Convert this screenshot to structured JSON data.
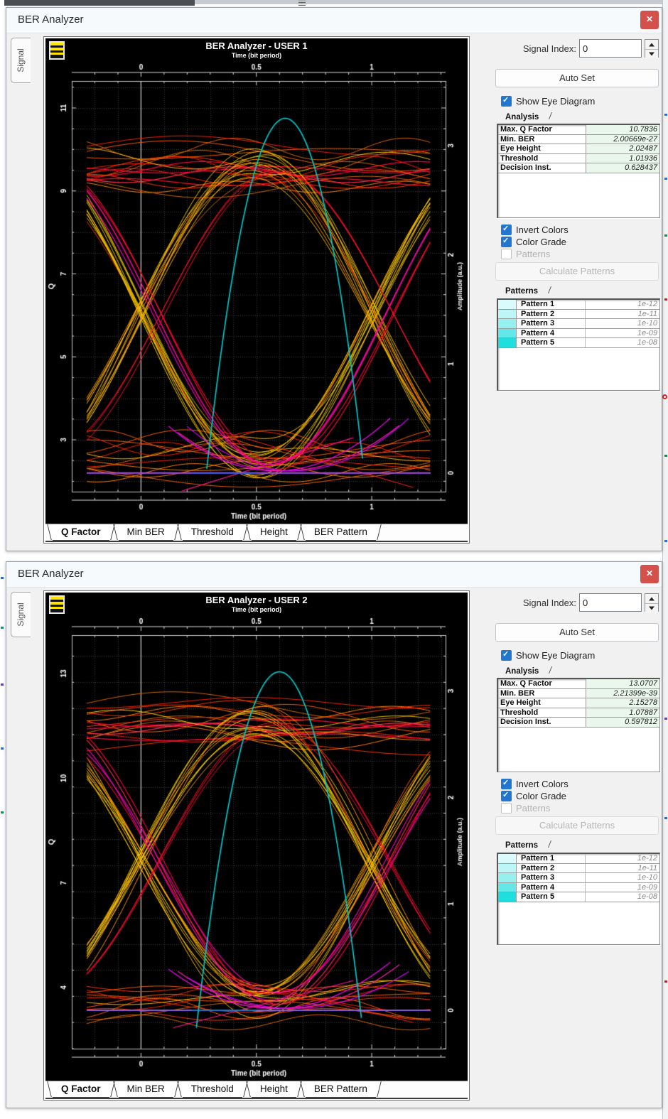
{
  "windows": [
    {
      "title": "BER Analyzer",
      "signal_tab_label": "Signal",
      "plot_title": "BER Analyzer - USER 1",
      "plot_subtitle": "Time (bit period)",
      "controls": {
        "signal_index_label": "Signal Index:",
        "signal_index_value": "0",
        "auto_set_label": "Auto Set",
        "show_eye_label": "Show Eye Diagram",
        "show_eye_checked": true,
        "analysis_tab_label": "Analysis",
        "analysis_rows": [
          [
            "Max. Q Factor",
            "10.7836"
          ],
          [
            "Min. BER",
            "2.00669e-27"
          ],
          [
            "Eye Height",
            "2.02487"
          ],
          [
            "Threshold",
            "1.01936"
          ],
          [
            "Decision Inst.",
            "0.628437"
          ]
        ],
        "invert_colors_label": "Invert Colors",
        "invert_colors_checked": true,
        "color_grade_label": "Color Grade",
        "color_grade_checked": true,
        "patterns_checkbox_label": "Patterns",
        "patterns_checked": false,
        "calculate_patterns_label": "Calculate Patterns",
        "patterns_tab_label": "Patterns",
        "pattern_rows": [
          {
            "name": "Pattern 1",
            "value": "1e-12",
            "color": "#d9fbfb"
          },
          {
            "name": "Pattern 2",
            "value": "1e-11",
            "color": "#bdf6f6"
          },
          {
            "name": "Pattern 3",
            "value": "1e-10",
            "color": "#97f0f0"
          },
          {
            "name": "Pattern 4",
            "value": "1e-09",
            "color": "#62e8e8"
          },
          {
            "name": "Pattern 5",
            "value": "1e-08",
            "color": "#1edede"
          }
        ]
      },
      "sheet_tabs": [
        "Q Factor",
        "Min BER",
        "Threshold",
        "Height",
        "BER Pattern"
      ],
      "active_sheet_tab": 0
    },
    {
      "title": "BER Analyzer",
      "signal_tab_label": "Signal",
      "plot_title": "BER Analyzer - USER 2",
      "plot_subtitle": "Time (bit period)",
      "controls": {
        "signal_index_label": "Signal Index:",
        "signal_index_value": "0",
        "auto_set_label": "Auto Set",
        "show_eye_label": "Show Eye Diagram",
        "show_eye_checked": true,
        "analysis_tab_label": "Analysis",
        "analysis_rows": [
          [
            "Max. Q Factor",
            "13.0707"
          ],
          [
            "Min. BER",
            "2.21399e-39"
          ],
          [
            "Eye Height",
            "2.15278"
          ],
          [
            "Threshold",
            "1.07887"
          ],
          [
            "Decision Inst.",
            "0.597812"
          ]
        ],
        "invert_colors_label": "Invert Colors",
        "invert_colors_checked": true,
        "color_grade_label": "Color Grade",
        "color_grade_checked": true,
        "patterns_checkbox_label": "Patterns",
        "patterns_checked": false,
        "calculate_patterns_label": "Calculate Patterns",
        "patterns_tab_label": "Patterns",
        "pattern_rows": [
          {
            "name": "Pattern 1",
            "value": "1e-12",
            "color": "#d9fbfb"
          },
          {
            "name": "Pattern 2",
            "value": "1e-11",
            "color": "#bdf6f6"
          },
          {
            "name": "Pattern 3",
            "value": "1e-10",
            "color": "#97f0f0"
          },
          {
            "name": "Pattern 4",
            "value": "1e-09",
            "color": "#62e8e8"
          },
          {
            "name": "Pattern 5",
            "value": "1e-08",
            "color": "#1edede"
          }
        ]
      },
      "sheet_tabs": [
        "Q Factor",
        "Min BER",
        "Threshold",
        "Height",
        "BER Pattern"
      ],
      "active_sheet_tab": 0
    }
  ],
  "chart_data": [
    {
      "type": "line",
      "subtype": "eye-diagram",
      "title": "BER Analyzer - USER 1",
      "xlabel": "Time (bit period)",
      "ylabel_left": "Q",
      "ylabel_right": "Amplitude (a.u.)",
      "x_range": [
        -0.3,
        1.32
      ],
      "y_range": [
        1.75,
        11.65
      ],
      "x_ticks": [
        0,
        0.5,
        1
      ],
      "x_tick_labels": [
        "0",
        "0.5",
        "1"
      ],
      "x_minor_step": 0.1,
      "y_major_ticks": [
        3,
        5,
        7,
        9,
        11
      ],
      "y_minor_step": 0.5,
      "right_ticks": [
        "0",
        "1",
        "2",
        "3"
      ],
      "right_tick_q": [
        2.2,
        4.83,
        7.46,
        10.09
      ],
      "rails": {
        "one": 9.55,
        "one_spread": 0.75,
        "zero": 2.55,
        "zero_spread": 0.5
      },
      "eye": {
        "mid": 6.05,
        "amp": 3.55
      },
      "zero_line_q": 2.2,
      "q_curve": {
        "peak_t": 0.625,
        "peak_q": 10.75,
        "base_q": 2.3,
        "half_width": 0.34
      },
      "analysis": {
        "max_q_factor": 10.7836,
        "min_ber": "2.00669e-27",
        "eye_height": 2.02487,
        "threshold": 1.01936,
        "decision_inst": 0.628437
      },
      "colors": {
        "transition": [
          "#ffd400",
          "#e8c400",
          "#ffbb00",
          "#d2b800",
          "#ff9500"
        ],
        "rail": [
          "#ff3a00",
          "#ff5f00",
          "#ff8400",
          "#d96a00",
          "#ff2200"
        ],
        "hot": [
          "#ff0f2a",
          "#ff2d55",
          "#ff0040"
        ],
        "magenta": "#ff00ff",
        "pink": "#ff1493",
        "blue": "#2a2ae0",
        "cyan": "#00c8c8",
        "grid": "#3d3d3d",
        "frame": "#cccccc"
      },
      "seed": 7
    },
    {
      "type": "line",
      "subtype": "eye-diagram",
      "title": "BER Analyzer - USER 2",
      "xlabel": "Time (bit period)",
      "ylabel_left": "Q",
      "ylabel_right": "Amplitude (a.u.)",
      "x_range": [
        -0.3,
        1.32
      ],
      "y_range": [
        2.25,
        14.1
      ],
      "x_ticks": [
        0,
        0.5,
        1
      ],
      "x_tick_labels": [
        "0",
        "0.5",
        "1"
      ],
      "x_minor_step": 0.1,
      "y_major_ticks": [
        4,
        7,
        10,
        13
      ],
      "y_minor_step": 0.75,
      "right_ticks": [
        "0",
        "1",
        "2",
        "3"
      ],
      "right_tick_q": [
        3.35,
        6.4,
        9.45,
        12.5
      ],
      "rails": {
        "one": 11.6,
        "one_spread": 0.85,
        "zero": 3.55,
        "zero_spread": 0.6
      },
      "eye": {
        "mid": 7.6,
        "amp": 4.0
      },
      "zero_line_q": 3.35,
      "q_curve": {
        "peak_t": 0.6,
        "peak_q": 13.05,
        "base_q": 2.85,
        "half_width": 0.36
      },
      "analysis": {
        "max_q_factor": 13.0707,
        "min_ber": "2.21399e-39",
        "eye_height": 2.15278,
        "threshold": 1.07887,
        "decision_inst": 0.597812
      },
      "colors": {
        "transition": [
          "#ffd400",
          "#e8c400",
          "#ffbb00",
          "#d2b800",
          "#ff9500"
        ],
        "rail": [
          "#ff3a00",
          "#ff5f00",
          "#ff8400",
          "#d96a00",
          "#ff2200"
        ],
        "hot": [
          "#ff0f2a",
          "#ff2d55",
          "#ff0040"
        ],
        "magenta": "#ff00ff",
        "pink": "#ff1493",
        "blue": "#2a2ae0",
        "cyan": "#00c8c8",
        "grid": "#3d3d3d",
        "frame": "#cccccc"
      },
      "seed": 13
    }
  ]
}
